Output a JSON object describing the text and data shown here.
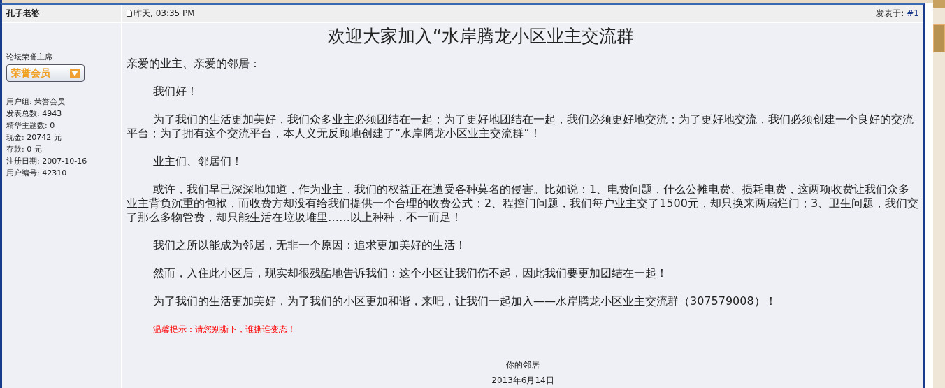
{
  "post": {
    "author": "孔子老婆",
    "time": "昨天, 03:35 PM",
    "posted_label": "发表于:",
    "post_number": "#1"
  },
  "user": {
    "title": "论坛荣誉主席",
    "badge": "荣誉会员",
    "stats": [
      {
        "label": "用户组:",
        "value": "荣誉会员"
      },
      {
        "label": "发表总数:",
        "value": "4943"
      },
      {
        "label": "精华主题数:",
        "value": "0"
      },
      {
        "label": "现金:",
        "value": "20742 元"
      },
      {
        "label": "存款:",
        "value": "0 元"
      },
      {
        "label": "注册日期:",
        "value": "2007-10-16"
      },
      {
        "label": "用户编号:",
        "value": "42310"
      }
    ]
  },
  "content": {
    "heading": "欢迎大家加入“水岸腾龙小区业主交流群",
    "greeting": "亲爱的业主、亲爱的邻居：",
    "paragraphs": [
      {
        "kind": "normal",
        "text": "我们好！"
      },
      {
        "kind": "normal",
        "text": "为了我们的生活更加美好，我们众多业主必须团结在一起；为了更好地团结在一起，我们必须更好地交流；为了更好地交流，我们必须创建一个良好的交流平台；为了拥有这个交流平台，本人义无反顾地创建了“水岸腾龙小区业主交流群”！"
      },
      {
        "kind": "normal",
        "text": "业主们、邻居们！"
      },
      {
        "kind": "normal",
        "text": "或许，我们早已深深地知道，作为业主，我们的权益正在遭受各种莫名的侵害。比如说：1、电费问题，什么公摊电费、损耗电费，这两项收费让我们众多业主背负沉重的包袱，而收费方却没有给我们提供一个合理的收费公式；2、程控门问题，我们每户业主交了1500元，却只换来两扇烂门；3、卫生问题，我们交了那么多物管费，却只能生活在垃圾堆里……以上种种，不一而足！"
      },
      {
        "kind": "normal",
        "text": "我们之所以能成为邻居，无非一个原因：追求更加美好的生活！"
      },
      {
        "kind": "normal",
        "text": "然而，入住此小区后，现实却很残酷地告诉我们：这个小区让我们伤不起，因此我们要更加团结在一起！"
      },
      {
        "kind": "normal",
        "text": "为了我们的生活更加美好，为了我们的小区更加和谐，来吧，让我们一起加入——水岸腾龙小区业主交流群（307579008）！"
      },
      {
        "kind": "warning",
        "text": "温馨提示：请您别撕下，谁撕谁变态！"
      }
    ],
    "signature": "你的邻居",
    "date": "2013年6月14日"
  }
}
